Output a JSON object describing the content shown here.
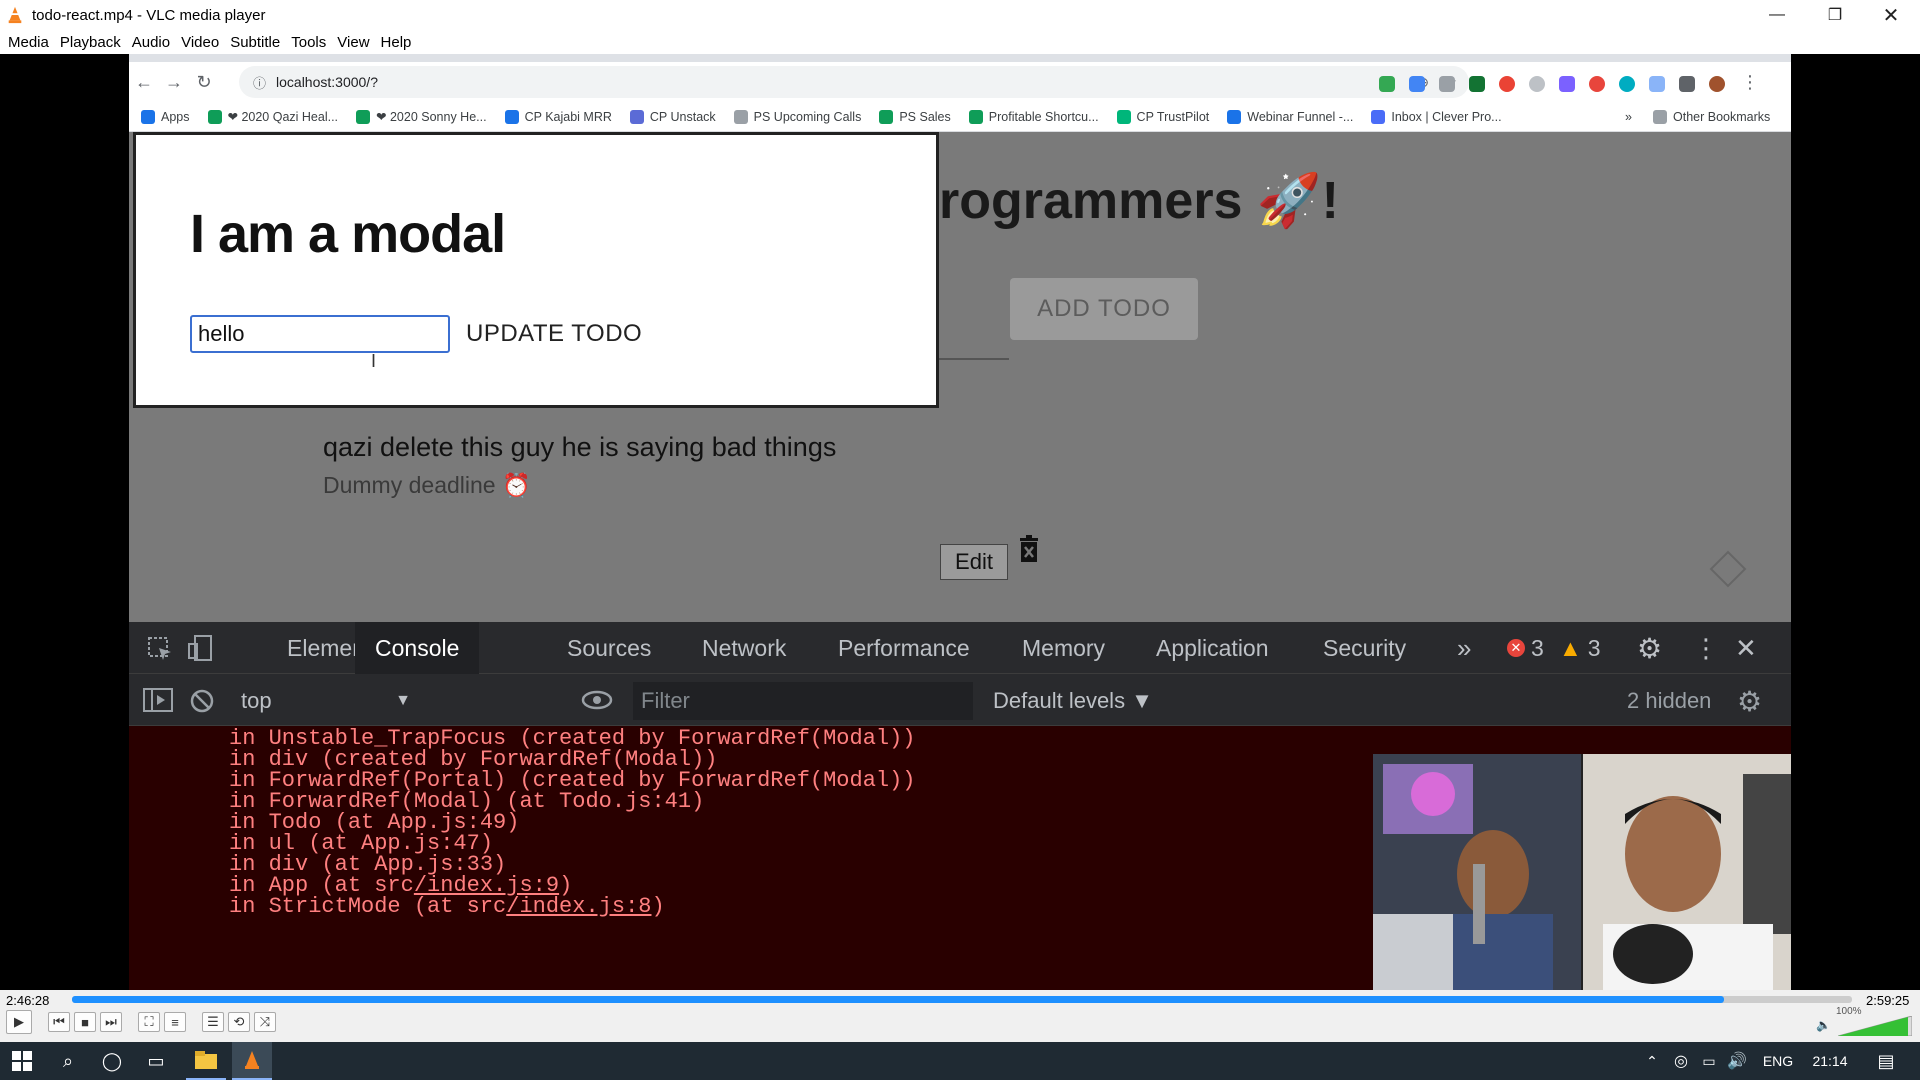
{
  "window": {
    "title": "todo-react.mp4 - VLC media player"
  },
  "menu": [
    "Media",
    "Playback",
    "Audio",
    "Video",
    "Subtitle",
    "Tools",
    "View",
    "Help"
  ],
  "browser": {
    "url": "localhost:3000/?",
    "bookmarks": [
      {
        "label": "Apps",
        "color": "#1a73e8"
      },
      {
        "label": "❤ 2020 Qazi Heal...",
        "color": "#0f9d58"
      },
      {
        "label": "❤ 2020 Sonny He...",
        "color": "#0f9d58"
      },
      {
        "label": "CP Kajabi MRR",
        "color": "#1a73e8"
      },
      {
        "label": "CP Unstack",
        "color": "#5b6bd6"
      },
      {
        "label": "PS Upcoming Calls",
        "color": "#9aa0a6"
      },
      {
        "label": "PS Sales",
        "color": "#0f9d58"
      },
      {
        "label": "Profitable Shortcu...",
        "color": "#0f9d58"
      },
      {
        "label": "CP TrustPilot",
        "color": "#00b67a"
      },
      {
        "label": "Webinar Funnel -...",
        "color": "#1a73e8"
      },
      {
        "label": "Inbox | Clever Pro...",
        "color": "#4a6cf7"
      }
    ],
    "bookmarks_more": "»",
    "other_bookmarks": "Other Bookmarks"
  },
  "page": {
    "heading": "rogrammers 🚀!",
    "add_todo": "ADD TODO",
    "todo_text": "qazi delete this guy he is saying bad things",
    "deadline": "Dummy deadline ⏰",
    "edit": "Edit"
  },
  "modal": {
    "title": "I am a modal",
    "input_value": "hello",
    "update_button": "UPDATE TODO"
  },
  "devtools": {
    "tabs": [
      "Elements",
      "Console",
      "Sources",
      "Network",
      "Performance",
      "Memory",
      "Application",
      "Security"
    ],
    "active_tab": "Console",
    "error_count": "3",
    "warning_count": "3",
    "context": "top",
    "filter_placeholder": "Filter",
    "levels": "Default levels ▼",
    "hidden": "2 hidden",
    "console_lines": [
      {
        "pre": "in Unstable_TrapFocus (created by ForwardRef(Modal))",
        "link": "",
        "post": ""
      },
      {
        "pre": "in div (created by ForwardRef(Modal))",
        "link": "",
        "post": ""
      },
      {
        "pre": "in ForwardRef(Portal) (created by ForwardRef(Modal))",
        "link": "",
        "post": ""
      },
      {
        "pre": "in ForwardRef(Modal) (at Todo.js:41)",
        "link": "",
        "post": ""
      },
      {
        "pre": "in Todo (at App.js:49)",
        "link": "",
        "post": ""
      },
      {
        "pre": "in ul (at App.js:47)",
        "link": "",
        "post": ""
      },
      {
        "pre": "in div (at App.js:33)",
        "link": "",
        "post": ""
      },
      {
        "pre": "in App (at src",
        "link": "/index.js:9",
        "post": ")"
      },
      {
        "pre": "in StrictMode (at src",
        "link": "/index.js:8",
        "post": ")"
      }
    ]
  },
  "player": {
    "elapsed": "2:46:28",
    "total": "2:59:25",
    "progress": 0.928,
    "volume": "100%"
  },
  "taskbar": {
    "lang": "ENG",
    "time": "21:14"
  }
}
